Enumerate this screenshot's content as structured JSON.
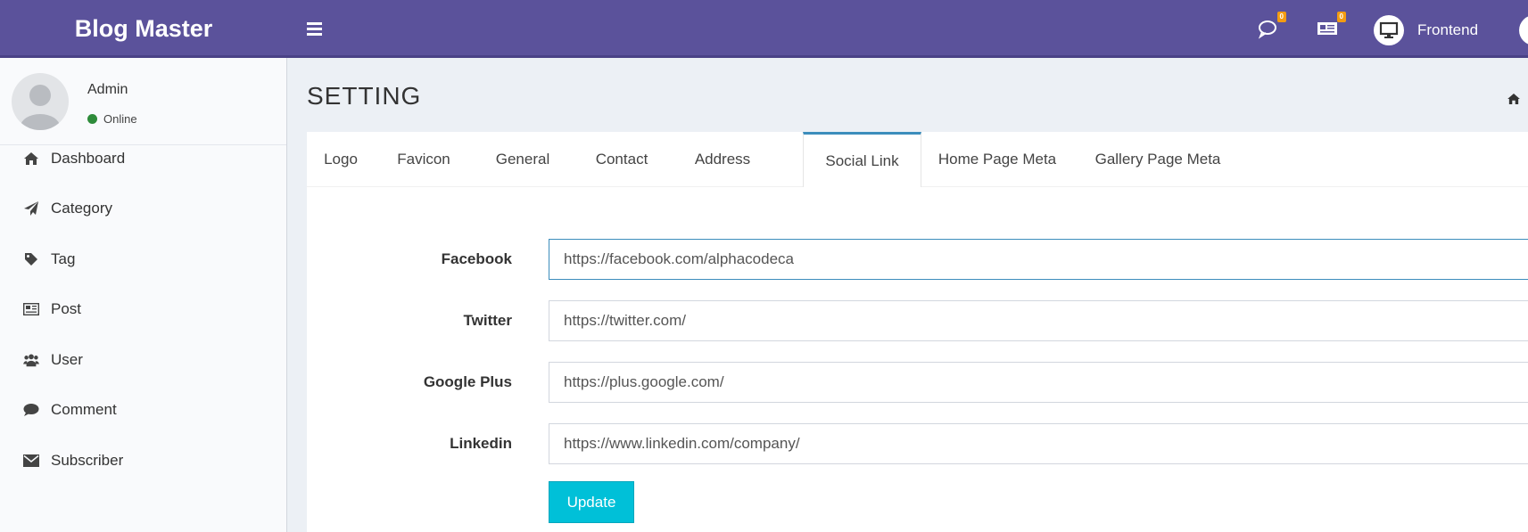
{
  "header": {
    "logo": "Blog Master",
    "comments_badge": "0",
    "posts_badge": "0",
    "frontend_label": "Frontend"
  },
  "sidebar": {
    "user": {
      "name": "Admin",
      "status": "Online"
    },
    "items": [
      {
        "label": "Dashboard",
        "icon": "home-icon"
      },
      {
        "label": "Category",
        "icon": "paper-plane-icon"
      },
      {
        "label": "Tag",
        "icon": "tag-icon"
      },
      {
        "label": "Post",
        "icon": "newspaper-icon"
      },
      {
        "label": "User",
        "icon": "users-icon"
      },
      {
        "label": "Comment",
        "icon": "comment-icon"
      },
      {
        "label": "Subscriber",
        "icon": "envelope-icon"
      }
    ]
  },
  "page": {
    "title": "SETTING"
  },
  "tabs": [
    {
      "label": "Logo"
    },
    {
      "label": "Favicon"
    },
    {
      "label": "General"
    },
    {
      "label": "Contact"
    },
    {
      "label": "Address"
    },
    {
      "label": "Social Link",
      "active": true
    },
    {
      "label": "Home Page Meta"
    },
    {
      "label": "Gallery Page Meta"
    }
  ],
  "form": {
    "facebook": {
      "label": "Facebook",
      "value": "https://facebook.com/alphacodeca"
    },
    "twitter": {
      "label": "Twitter",
      "value": "https://twitter.com/"
    },
    "google_plus": {
      "label": "Google Plus",
      "value": "https://plus.google.com/"
    },
    "linkedin": {
      "label": "Linkedin",
      "value": "https://www.linkedin.com/company/"
    },
    "update_label": "Update"
  },
  "colors": {
    "header": "#5b529b",
    "active_tab_border": "#3c8dbc",
    "update_button": "#00c0d8",
    "status_online": "#2e8b3a",
    "badge": "#f39c12"
  }
}
